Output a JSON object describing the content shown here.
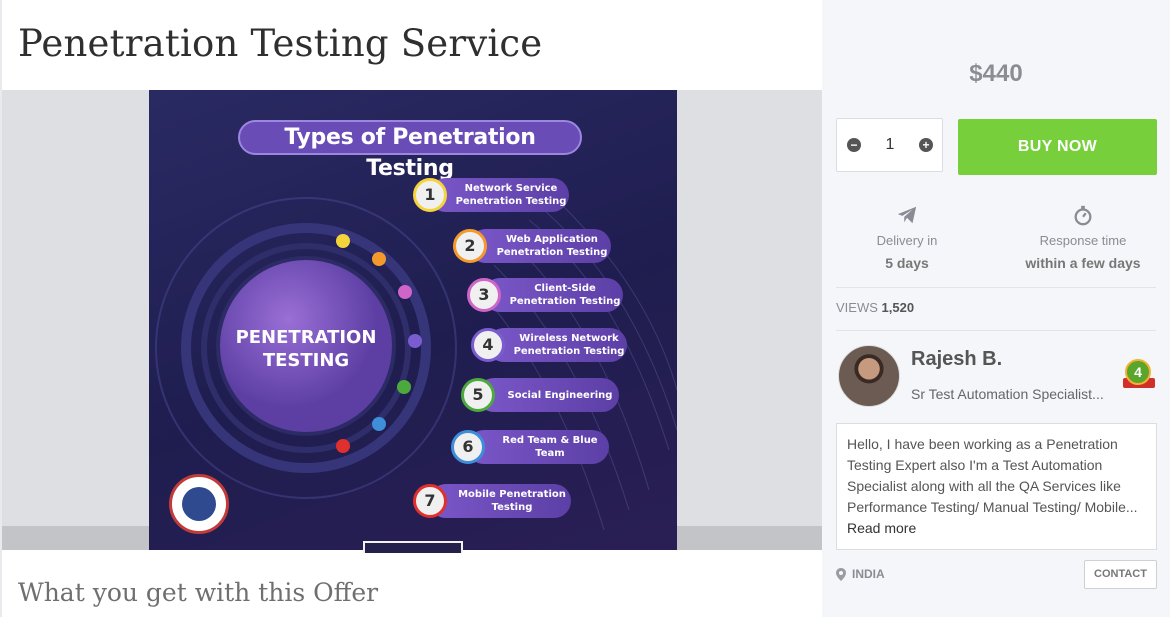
{
  "title": "Penetration Testing Service",
  "offer_heading": "What you get with this Offer",
  "image": {
    "heading": "Types of Penetration Testing",
    "center_line1": "PENETRATION",
    "center_line2": "TESTING",
    "items": [
      {
        "num": "1",
        "label": "Network Service Penetration Testing",
        "ring": "#f4d33b"
      },
      {
        "num": "2",
        "label": "Web Application Penetration Testing",
        "ring": "#f39a2b"
      },
      {
        "num": "3",
        "label": "Client-Side Penetration Testing",
        "ring": "#d065c8"
      },
      {
        "num": "4",
        "label": "Wireless Network Penetration Testing",
        "ring": "#7a5cd1"
      },
      {
        "num": "5",
        "label": "Social Engineering",
        "ring": "#4caa3d"
      },
      {
        "num": "6",
        "label": "Red Team & Blue Team",
        "ring": "#3e8ed9"
      },
      {
        "num": "7",
        "label": "Mobile Penetration Testing",
        "ring": "#e0302d"
      }
    ]
  },
  "sidebar": {
    "price": "$440",
    "quantity": "1",
    "buy_label": "BUY NOW",
    "delivery_label": "Delivery in",
    "delivery_value": "5 days",
    "response_label": "Response time",
    "response_value": "within a few days",
    "views_label": "VIEWS",
    "views_value": "1,520",
    "seller_name": "Rajesh B.",
    "seller_role": "Sr Test Automation Specialist...",
    "level": "4",
    "bio": "Hello, I have been working as a Penetration Testing Expert also I'm a Test Automation Specialist along with all the QA Services like Performance Testing/ Manual Testing/ Mobile...",
    "read_more": "Read more",
    "location": "INDIA",
    "contact_label": "CONTACT"
  },
  "colors": {
    "buy_button": "#76cf3b",
    "hero_background": "#24225a",
    "sidebar_background": "#f5f6fa"
  }
}
